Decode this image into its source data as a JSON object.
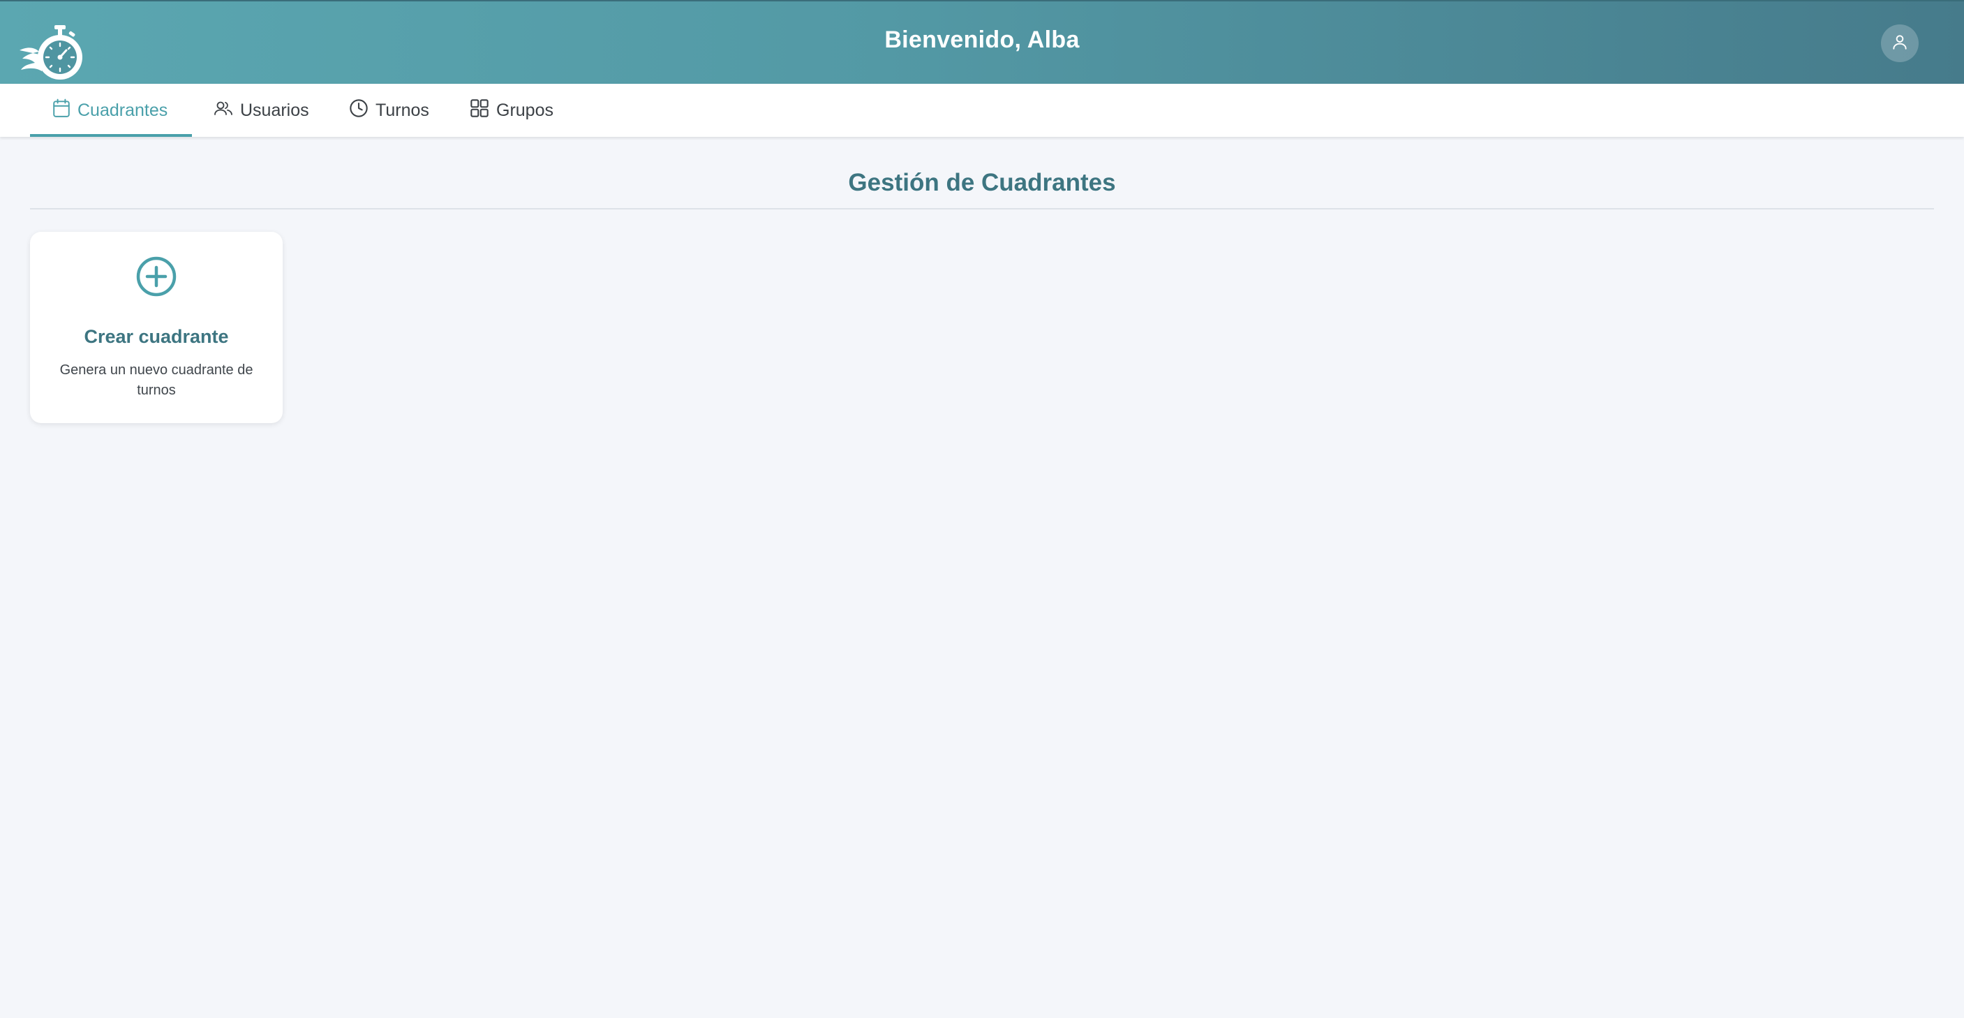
{
  "header": {
    "title": "Bienvenido, Alba",
    "logo_icon": "stopwatch-icon",
    "user_icon": "user-icon"
  },
  "nav": {
    "items": [
      {
        "label": "Cuadrantes",
        "icon": "calendar-icon",
        "active": true
      },
      {
        "label": "Usuarios",
        "icon": "users-icon",
        "active": false
      },
      {
        "label": "Turnos",
        "icon": "clock-icon",
        "active": false
      },
      {
        "label": "Grupos",
        "icon": "grid-icon",
        "active": false
      }
    ]
  },
  "main": {
    "title": "Gestión de Cuadrantes",
    "cards": [
      {
        "title": "Crear cuadrante",
        "description": "Genera un nuevo cuadrante de turnos",
        "icon": "plus-circle-icon"
      }
    ]
  },
  "colors": {
    "accent": "#4aa0aa",
    "header_gradient_start": "#5ba7b1",
    "header_gradient_end": "#467b8b",
    "title_color": "#3d7581",
    "background": "#f4f6fa"
  }
}
